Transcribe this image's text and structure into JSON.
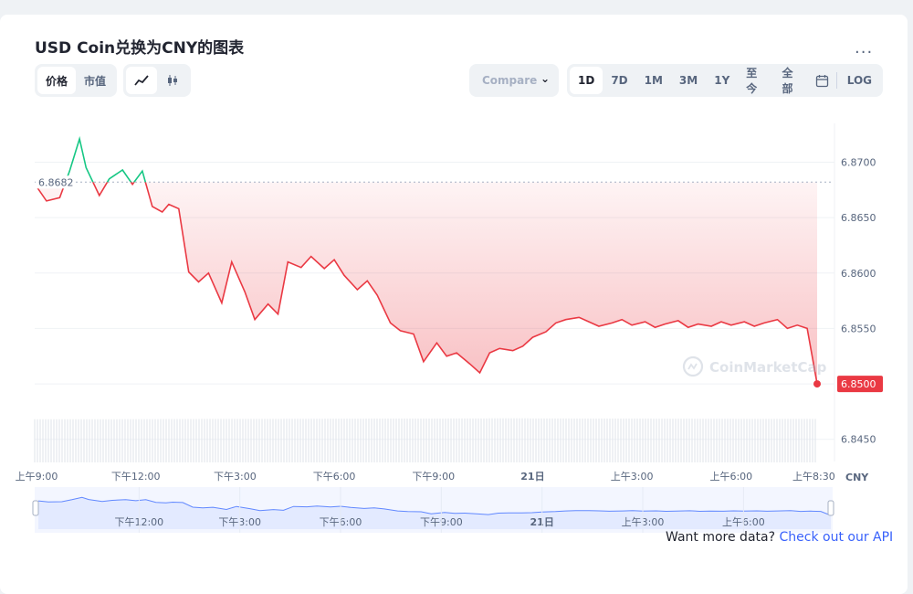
{
  "page": {
    "title": "USD Coin兑换为CNY的图表",
    "more_label": "...",
    "tabs_type": [
      {
        "label": "价格",
        "active": true
      },
      {
        "label": "市值",
        "active": false
      }
    ],
    "tabs_style": [
      {
        "icon": "line-chart-icon",
        "active": true
      },
      {
        "icon": "candlestick-icon",
        "active": false
      }
    ],
    "compare_label": "Compare ",
    "ranges": [
      {
        "label": "1D",
        "active": true
      },
      {
        "label": "7D",
        "active": false
      },
      {
        "label": "1M",
        "active": false
      },
      {
        "label": "3M",
        "active": false
      },
      {
        "label": "1Y",
        "active": false
      },
      {
        "label": "至今",
        "active": false
      },
      {
        "label": "全部",
        "active": false
      }
    ],
    "log_label": "LOG",
    "watermark": "CoinMarketCap",
    "api_prefix": "Want more data?",
    "api_link": "Check out our API",
    "colors": {
      "up": "#16c784",
      "down": "#ea3943",
      "grid": "#eff2f5",
      "nav_fill": "#e3eaff",
      "nav_line": "#6188ff"
    }
  },
  "chart_data": {
    "type": "line",
    "ylim": [
      6.843,
      6.8735
    ],
    "yticks": [
      6.845,
      6.85,
      6.855,
      6.86,
      6.865,
      6.87
    ],
    "ytick_labels": [
      "6.8450",
      "6.8500",
      "6.8550",
      "6.8600",
      "6.8650",
      "6.8700"
    ],
    "xticks": [
      0,
      3,
      6,
      9,
      12,
      15,
      18,
      21,
      23.5
    ],
    "xtick_labels": [
      "上午9:00",
      "下午12:00",
      "下午3:00",
      "下午6:00",
      "下午9:00",
      "21日",
      "上午3:00",
      "上午6:00",
      "上午8:30"
    ],
    "nav_ticks": [
      3,
      6,
      9,
      12,
      15,
      18,
      21
    ],
    "nav_tick_labels": [
      "下午12:00",
      "下午3:00",
      "下午6:00",
      "下午9:00",
      "21日",
      "上午3:00",
      "上午6:00"
    ],
    "currency_label": "CNY",
    "open_value": 6.8682,
    "open_label": "6.8682",
    "last_value": 6.85,
    "last_label": "6.8500",
    "x": [
      0,
      0.3,
      0.7,
      1.0,
      1.3,
      1.5,
      1.9,
      2.2,
      2.6,
      2.9,
      3.2,
      3.5,
      3.8,
      4.0,
      4.3,
      4.6,
      4.9,
      5.2,
      5.6,
      5.9,
      6.3,
      6.6,
      7.0,
      7.3,
      7.6,
      8.0,
      8.3,
      8.7,
      9.0,
      9.3,
      9.7,
      10.0,
      10.3,
      10.7,
      11.0,
      11.4,
      11.7,
      12.1,
      12.4,
      12.7,
      13.1,
      13.4,
      13.7,
      14.0,
      14.4,
      14.7,
      15.0,
      15.4,
      15.7,
      16.0,
      16.4,
      16.7,
      17.0,
      17.4,
      17.7,
      18.0,
      18.4,
      18.7,
      19.0,
      19.4,
      19.7,
      20.0,
      20.4,
      20.7,
      21.0,
      21.4,
      21.7,
      22.0,
      22.4,
      22.7,
      23.0,
      23.3,
      23.6
    ],
    "values": [
      6.8678,
      6.8665,
      6.8668,
      6.8692,
      6.8721,
      6.8695,
      6.867,
      6.8685,
      6.8693,
      6.868,
      6.8692,
      6.866,
      6.8655,
      6.8662,
      6.8658,
      6.8601,
      6.8592,
      6.86,
      6.8573,
      6.861,
      6.8583,
      6.8558,
      6.8572,
      6.8563,
      6.861,
      6.8605,
      6.8615,
      6.8604,
      6.8612,
      6.8598,
      6.8585,
      6.8593,
      6.858,
      6.8555,
      6.8548,
      6.8545,
      6.852,
      6.8537,
      6.8525,
      6.8528,
      6.8518,
      6.851,
      6.8528,
      6.8532,
      6.853,
      6.8534,
      6.8542,
      6.8547,
      6.8555,
      6.8558,
      6.856,
      6.8556,
      6.8552,
      6.8555,
      6.8558,
      6.8553,
      6.8556,
      6.8551,
      6.8554,
      6.8557,
      6.8551,
      6.8554,
      6.8552,
      6.8556,
      6.8553,
      6.8556,
      6.8552,
      6.8555,
      6.8558,
      6.855,
      6.8553,
      6.855,
      6.85
    ],
    "volume_levels": [
      0.55,
      0.56,
      0.58,
      0.6,
      0.62,
      0.64,
      0.66,
      0.68,
      0.7,
      0.72,
      0.74,
      0.76,
      0.74,
      0.72,
      0.7,
      0.68,
      0.66,
      0.64,
      0.62
    ]
  }
}
